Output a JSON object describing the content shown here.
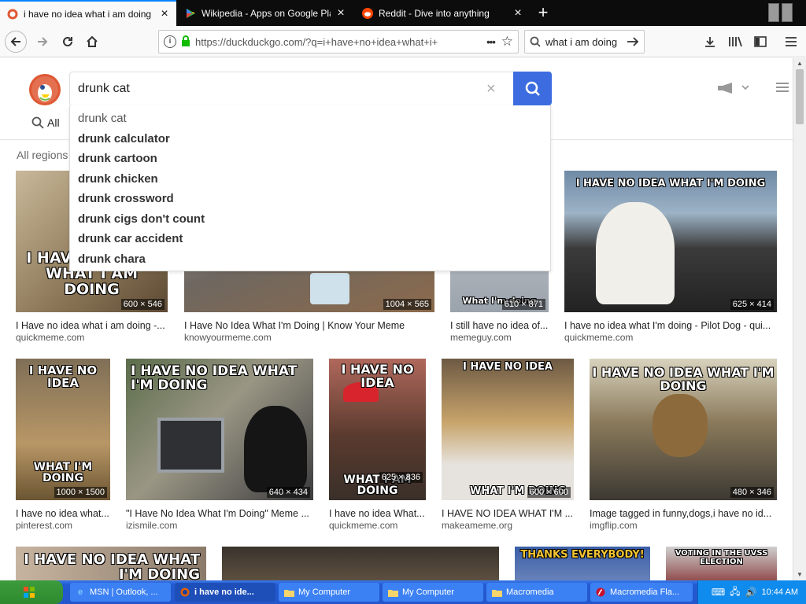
{
  "browser": {
    "tabs": [
      {
        "title": "i have no idea what i am doing at D",
        "active": true,
        "icon": "duckduckgo-icon"
      },
      {
        "title": "Wikipedia - Apps on Google Play",
        "active": false,
        "icon": "google-play-icon"
      },
      {
        "title": "Reddit - Dive into anything",
        "active": false,
        "icon": "reddit-icon"
      }
    ],
    "new_tab_label": "+",
    "url": "https://duckduckgo.com/?q=i+have+no+idea+what+i+",
    "search_value": "what i am doing",
    "page_actions": "•••"
  },
  "ddg": {
    "search_value": "drunk cat",
    "clear_label": "×",
    "all_label": "All",
    "regions_label": "All regions",
    "suggestions": [
      "drunk cat",
      "drunk calculator",
      "drunk cartoon",
      "drunk chicken",
      "drunk crossword",
      "drunk cigs don't count",
      "drunk car accident",
      "drunk chara"
    ]
  },
  "results": {
    "row1": [
      {
        "title": "I Have no idea what i am doing -...",
        "source": "quickmeme.com",
        "dims": "600 × 546",
        "caption": "I HAVE NO IDEA WHAT I AM DOING"
      },
      {
        "title": "I Have No Idea What I'm Doing | Know Your Meme",
        "source": "knowyourmeme.com",
        "dims": "1004 × 565",
        "caption": ""
      },
      {
        "title": "I still have no idea of...",
        "source": "memeguy.com",
        "dims": "610 × 871",
        "caption": "What I'm doing"
      },
      {
        "title": "I have no idea what I'm doing - Pilot Dog - qui...",
        "source": "quickmeme.com",
        "dims": "625 × 414",
        "caption": "I HAVE NO IDEA WHAT I'M DOING"
      }
    ],
    "row2": [
      {
        "title": "I have no idea what...",
        "source": "pinterest.com",
        "dims": "1000 × 1500",
        "caption_top": "I HAVE NO IDEA",
        "caption_bottom": "WHAT I'M DOING"
      },
      {
        "title": "\"I Have No Idea What I'm Doing\" Meme ...",
        "source": "izismile.com",
        "dims": "640 × 434",
        "caption_top": "I HAVE NO IDEA WHAT I'M DOING",
        "caption_bottom": ""
      },
      {
        "title": "I have no idea What...",
        "source": "quickmeme.com",
        "dims": "625 × 836",
        "caption_top": "I HAVE NO IDEA",
        "caption_bottom": "WHAT I AM DOING"
      },
      {
        "title": "I HAVE NO IDEA WHAT I'M ...",
        "source": "makeameme.org",
        "dims": "600 × 600",
        "caption_top": "I HAVE NO IDEA",
        "caption_bottom": "WHAT I'M DOING"
      },
      {
        "title": "Image tagged in funny,dogs,i have no id...",
        "source": "imgflip.com",
        "dims": "480 × 346",
        "caption_top": "I HAVE NO IDEA WHAT I'M DOING",
        "caption_bottom": ""
      }
    ],
    "row3": [
      {
        "caption": "I HAVE NO IDEA WHAT I'M DOING"
      },
      {
        "caption": ""
      },
      {
        "caption": "THANKS EVERYBODY!"
      },
      {
        "caption": "VOTING IN THE UVSS ELECTION"
      }
    ]
  },
  "taskbar": {
    "start_label": "start",
    "items": [
      {
        "label": "MSN | Outlook, ...",
        "active": false,
        "icon": "ie-icon"
      },
      {
        "label": "i have no ide...",
        "active": true,
        "icon": "firefox-icon"
      },
      {
        "label": "My Computer",
        "active": false,
        "icon": "folder-icon"
      },
      {
        "label": "My Computer",
        "active": false,
        "icon": "folder-icon"
      },
      {
        "label": "Macromedia",
        "active": false,
        "icon": "folder-icon"
      },
      {
        "label": "Macromedia Fla...",
        "active": false,
        "icon": "flash-icon"
      }
    ],
    "clock": "10:44 AM"
  }
}
